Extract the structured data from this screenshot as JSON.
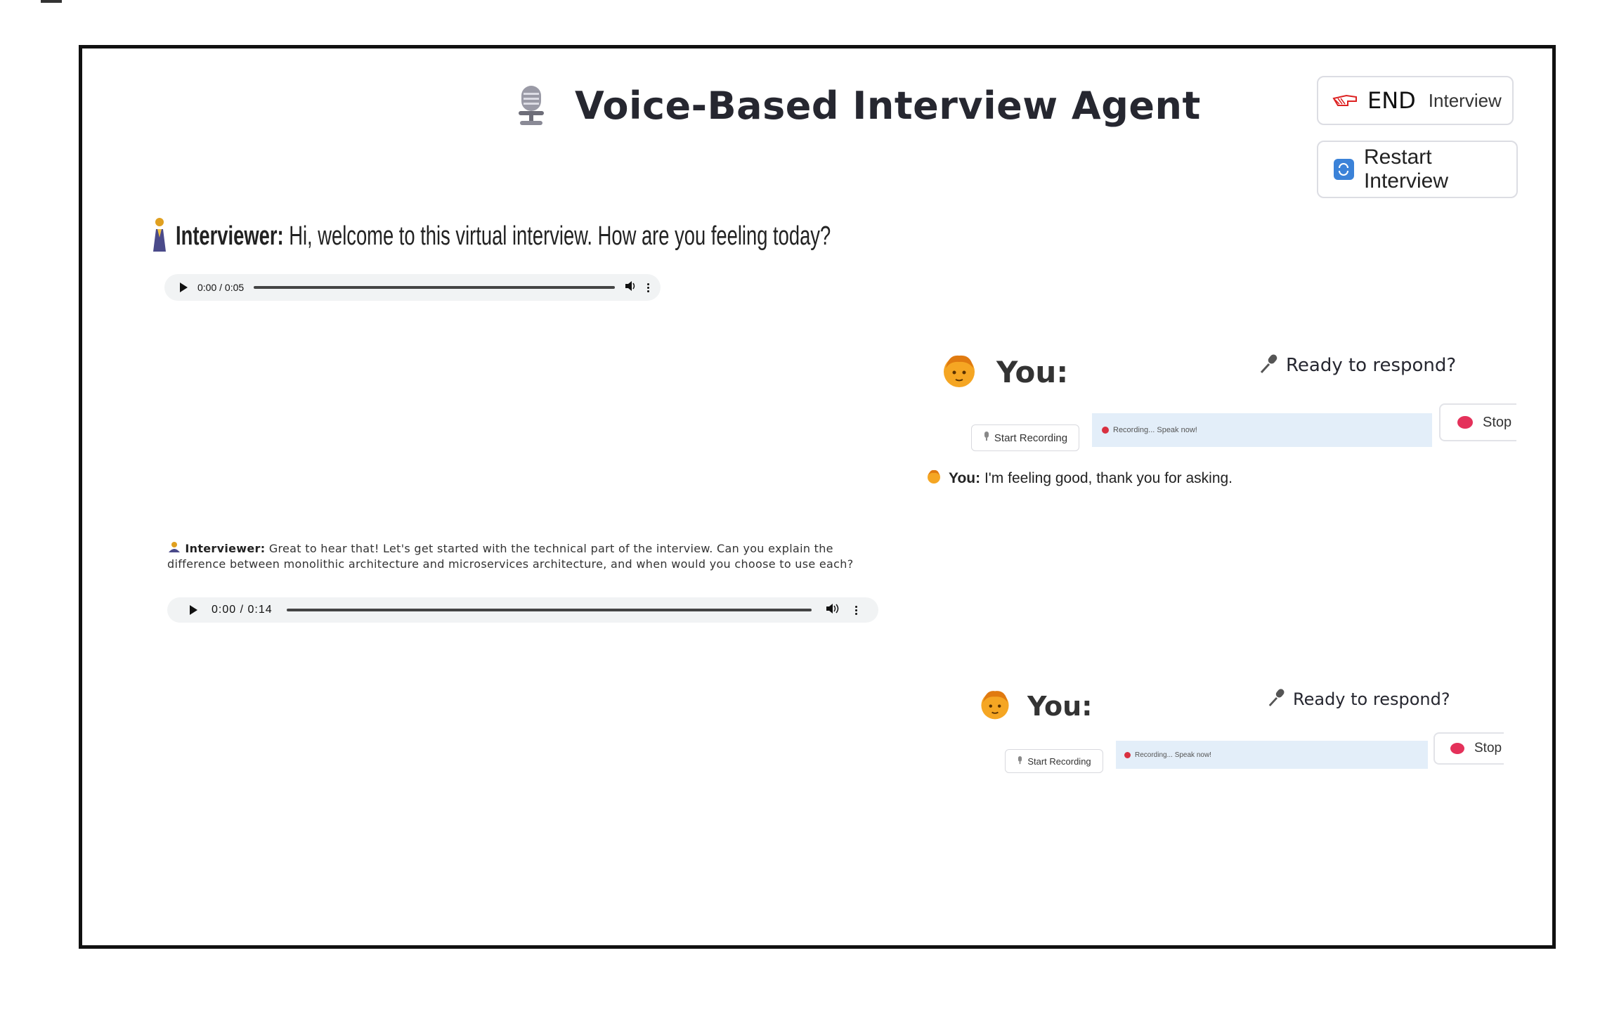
{
  "header": {
    "title": "Voice-Based Interview Agent",
    "title_icon": "studio-microphone-icon"
  },
  "controls": {
    "end_big": "END",
    "end_small": "Interview",
    "restart_label": "Restart Interview"
  },
  "conversation": {
    "turn1": {
      "speaker": "Interviewer:",
      "text": "Hi, welcome to this virtual interview. How are you feeling today?",
      "audio_time": "0:00 / 0:05"
    },
    "you1": {
      "label": "You:",
      "ready": "Ready to respond?",
      "start_recording": "Start Recording",
      "status": "Recording... Speak now!",
      "stop": "Stop",
      "answer_speaker": "You:",
      "answer_text": "I'm feeling good, thank you for asking."
    },
    "turn2": {
      "speaker": "Interviewer:",
      "text": "Great to hear that! Let's get started with the technical part of the interview. Can you explain the difference between monolithic architecture and microservices architecture, and when would you choose to use each?",
      "audio_time": "0:00 / 0:14"
    },
    "you2": {
      "label": "You:",
      "ready": "Ready to respond?",
      "start_recording": "Start Recording",
      "status": "Recording... Speak now!",
      "stop": "Stop"
    }
  },
  "colors": {
    "recording_bar": "#e3eef9",
    "stop_dot": "#e4315a",
    "restart_icon": "#3b82d8"
  }
}
